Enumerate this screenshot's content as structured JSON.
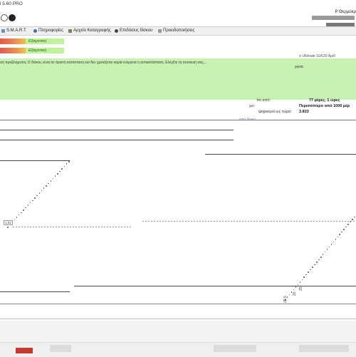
{
  "window": {
    "title": "l 5.60 PRO"
  },
  "drive_label": "Ρ  Θερμοκρ",
  "tabs": [
    {
      "label": "S.M.A.R.T.",
      "icon": "table-icon"
    },
    {
      "label": "Πληροφορίες",
      "icon": "info-icon"
    },
    {
      "label": "Αρχείο Καταγραφής",
      "icon": "log-icon"
    },
    {
      "label": "Επιδόσεις δίσκου",
      "icon": "disk-performance-icon"
    },
    {
      "label": "Προειδοποιήσεις",
      "icon": "warning-icon"
    }
  ],
  "status_rows": [
    {
      "label": "Εξαιρετική",
      "fill": 0.07
    },
    {
      "label": "Εξαιρετική",
      "fill": 0.07
    }
  ],
  "description": {
    "text": "ση προβλήματος Ο δίσκος είναι σε άριστη κατάσταση και δεν χρειάζεται καμία ενέργεια ή αντικατάσταση. Ελέγξτε τη συσκευή σας...",
    "model_text": "σ Ultimate SU630 Αριθ",
    "more": "ργεια."
  },
  "stats": [
    {
      "label": "ίτο από:",
      "value": "77 μέρες, 1 ώρες"
    },
    {
      "label": "μο:",
      "value": "Περισσότερο από 1000 μέρ"
    },
    {
      "label": "ψηφισμοί ως τώρα:",
      "value": "3.833"
    }
  ],
  "link_text": "από δίσκο ...",
  "chart": {
    "tag": "1,02",
    "x_ticks": [
      "20",
      "25",
      "25,5"
    ]
  }
}
